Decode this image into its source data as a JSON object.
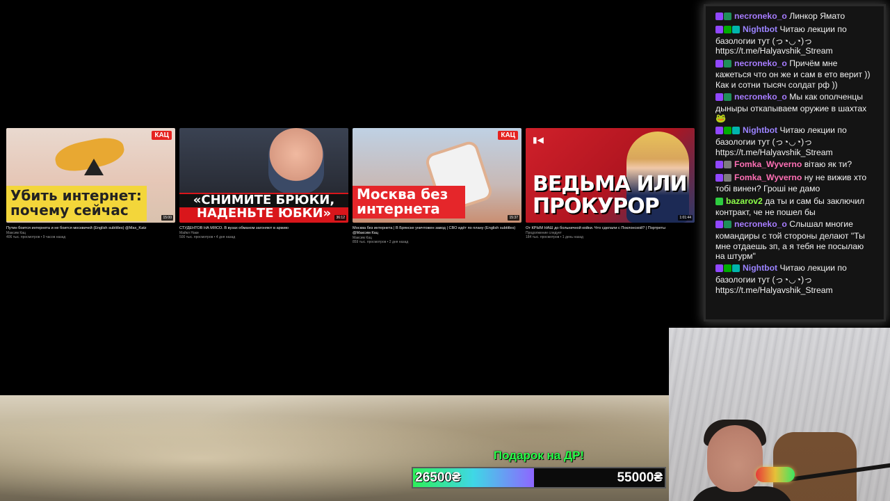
{
  "videos": [
    {
      "thumb_caption": "Убить интернет: почему сейчас",
      "badge": "КАЦ",
      "duration": "15:00",
      "title": "Путин боится интернета и не боится москвичей (English subtitles) @Max_Katz",
      "channel": "Максим Кац",
      "meta": "406 тыс. просмотров • 9 часов назад"
    },
    {
      "thumb_caption_line1": "«СНИМИТЕ БРЮКИ,",
      "thumb_caption_line2": "НАДЕНЬТЕ ЮБКИ»",
      "duration": "36:12",
      "title": "СТУДЕНТОВ НА МЯСО. В вузах обманом загоняют в армию",
      "channel": "Майкл Наки",
      "meta": "500 тыс. просмотров • 4 дня назад"
    },
    {
      "thumb_caption": "Москва без интернета",
      "badge": "КАЦ",
      "duration": "15:37",
      "title": "Москва без интернета | В Брянске уничтожен завод | СВО идёт по плану (English subtitles) @Максим Кац",
      "channel": "Максим Кац",
      "meta": "859 тыс. просмотров • 2 дня назад"
    },
    {
      "thumb_caption": "ВЕДЬМА ИЛИ ПРОКУРОР",
      "duration": "1:01:44",
      "title": "От КРЫМ НАШ до больничной койки. Что сделали с Поклонской? | Портреты",
      "channel": "Продолжение следует",
      "meta": "184 тыс. просмотров • 1 день назад"
    }
  ],
  "chat": [
    {
      "user": "necroneko_o",
      "color": "#a77cff",
      "badges": [
        "#9147ff",
        "#1f8f5a"
      ],
      "text": "Линкор Ямато"
    },
    {
      "user": "Nightbot",
      "color": "#9b83ff",
      "badges": [
        "#9147ff",
        "#00ad03",
        "#00b5ad"
      ],
      "text": "Читаю лекции по базологии тут (っ◔◡◔)っ https://t.me/Halyavshik_Stream"
    },
    {
      "user": "necroneko_o",
      "color": "#a77cff",
      "badges": [
        "#9147ff",
        "#1f8f5a"
      ],
      "text": "Причём мне кажеться что он же и сам в ето верит )) Как и сотни тысяч солдат рф ))"
    },
    {
      "user": "necroneko_o",
      "color": "#a77cff",
      "badges": [
        "#9147ff",
        "#1f8f5a"
      ],
      "text": "Мы как ополченцы дыныры откапываем оружие в шахтах 🐸"
    },
    {
      "user": "Nightbot",
      "color": "#9b83ff",
      "badges": [
        "#9147ff",
        "#00ad03",
        "#00b5ad"
      ],
      "text": "Читаю лекции по базологии тут (っ◔◡◔)っ https://t.me/Halyavshik_Stream"
    },
    {
      "user": "Fomka_Wyverno",
      "color": "#ff6fb5",
      "badges": [
        "#9147ff",
        "#7d7d7d"
      ],
      "text": "вітаю як ти?"
    },
    {
      "user": "Fomka_Wyverno",
      "color": "#ff6fb5",
      "badges": [
        "#9147ff",
        "#7d7d7d"
      ],
      "text": "ну не вижив хто тобі винен? Гроші не дамо"
    },
    {
      "user": "bazarov2",
      "color": "#8dff4a",
      "badges": [
        "#2ecc40"
      ],
      "text": "да ты и сам бы заключил контракт, че не пошел бы"
    },
    {
      "user": "necroneko_o",
      "color": "#a77cff",
      "badges": [
        "#9147ff",
        "#1f8f5a"
      ],
      "text": "Слышал многие командиры с той стороны делают \"Ты мне отдаешь зп, а я тебя не посылаю на штурм\""
    },
    {
      "user": "Nightbot",
      "color": "#9b83ff",
      "badges": [
        "#9147ff",
        "#00ad03",
        "#00b5ad"
      ],
      "text": "Читаю лекции по базологии тут (っ◔◡◔)っ https://t.me/Halyavshik_Stream"
    }
  ],
  "goal": {
    "title": "Подарок на ДР!",
    "current": "26500₴",
    "target": "55000₴",
    "progress": 0.48
  }
}
